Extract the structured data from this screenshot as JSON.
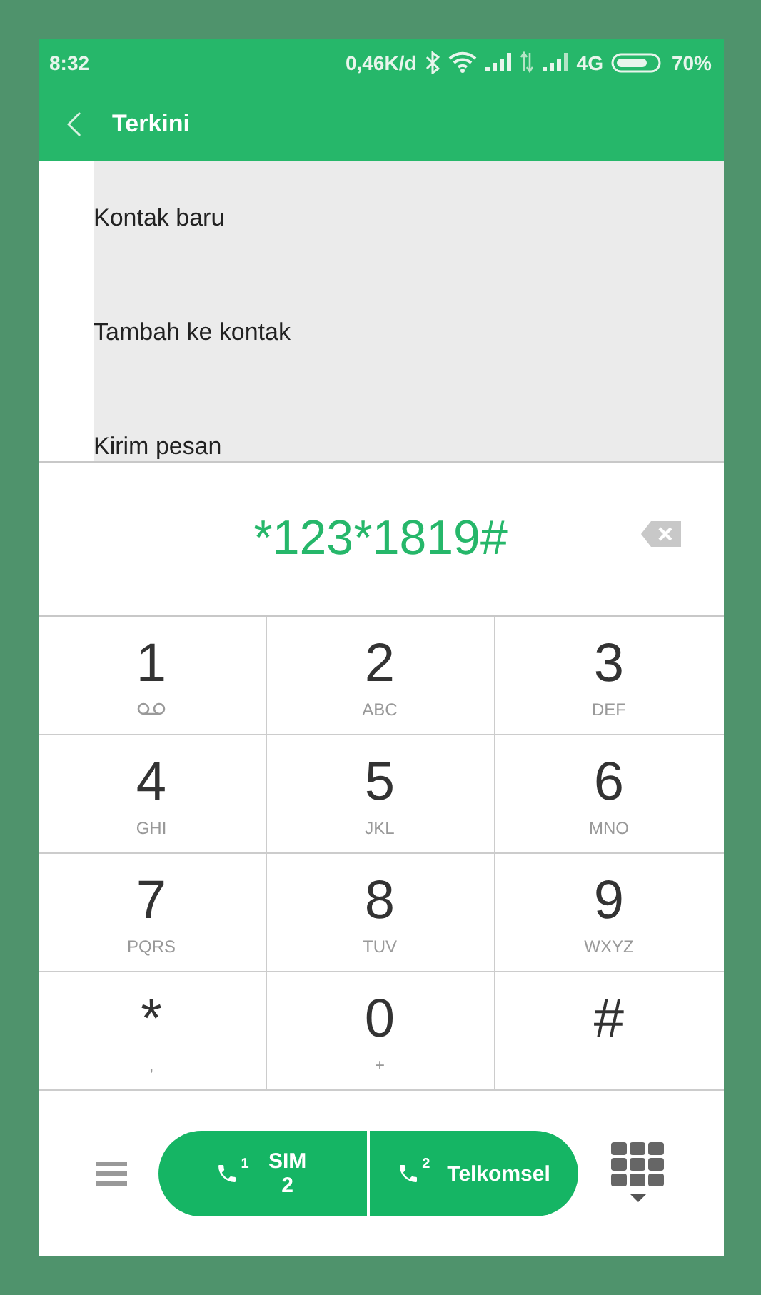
{
  "status_bar": {
    "time": "8:32",
    "network_speed": "0,46K/d",
    "network_type": "4G",
    "battery": "70%"
  },
  "app_bar": {
    "title": "Terkini"
  },
  "menu_items": [
    "Kontak baru",
    "Tambah ke kontak",
    "Kirim pesan"
  ],
  "dialed_number": "*123*1819#",
  "keys": [
    {
      "kind": "voicemail",
      "digit": "1"
    },
    {
      "kind": "letters",
      "digit": "2",
      "sub": "ABC"
    },
    {
      "kind": "letters",
      "digit": "3",
      "sub": "DEF"
    },
    {
      "kind": "letters",
      "digit": "4",
      "sub": "GHI"
    },
    {
      "kind": "letters",
      "digit": "5",
      "sub": "JKL"
    },
    {
      "kind": "letters",
      "digit": "6",
      "sub": "MNO"
    },
    {
      "kind": "letters",
      "digit": "7",
      "sub": "PQRS"
    },
    {
      "kind": "letters",
      "digit": "8",
      "sub": "TUV"
    },
    {
      "kind": "letters",
      "digit": "9",
      "sub": "WXYZ"
    },
    {
      "kind": "letters",
      "digit": "*",
      "sub": ","
    },
    {
      "kind": "letters",
      "digit": "0",
      "sub": "+"
    },
    {
      "kind": "letters",
      "digit": "#"
    }
  ],
  "call_buttons": [
    {
      "sim": "1",
      "label": "SIM 2"
    },
    {
      "sim": "2",
      "label": "Telkomsel"
    }
  ]
}
